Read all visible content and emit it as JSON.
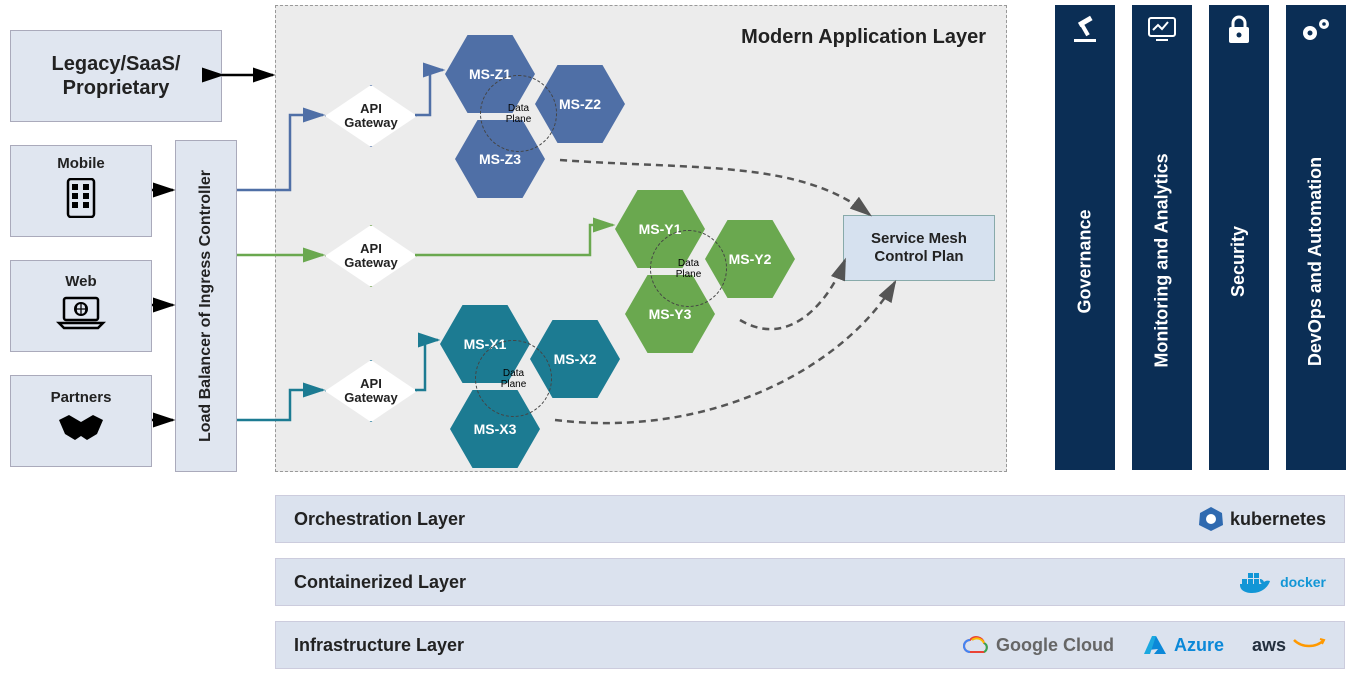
{
  "left": {
    "legacy": "Legacy/SaaS/\nProprietary",
    "clients": [
      {
        "label": "Mobile",
        "icon": "mobile-icon"
      },
      {
        "label": "Web",
        "icon": "laptop-icon"
      },
      {
        "label": "Partners",
        "icon": "handshake-icon"
      }
    ],
    "load_balancer": "Load Balancer of Ingress Controller"
  },
  "app_layer": {
    "title": "Modern Application Layer",
    "gateways": [
      "API\nGateway",
      "API\nGateway",
      "API\nGateway"
    ],
    "clusters": [
      {
        "color": "#4f6fa6",
        "nodes": [
          "MS-Z1",
          "MS-Z2",
          "MS-Z3"
        ],
        "data_plane": "Data\nPlane"
      },
      {
        "color": "#6aa84f",
        "nodes": [
          "MS-Y1",
          "MS-Y2",
          "MS-Y3"
        ],
        "data_plane": "Data\nPlane"
      },
      {
        "color": "#1c7b92",
        "nodes": [
          "MS-X1",
          "MS-X2",
          "MS-X3"
        ],
        "data_plane": "Data\nPlane"
      }
    ],
    "service_mesh": "Service Mesh\nControl Plan"
  },
  "pillars": [
    {
      "label": "Governance",
      "icon": "gavel-icon"
    },
    {
      "label": "Monitoring and Analytics",
      "icon": "analytics-icon"
    },
    {
      "label": "Security",
      "icon": "lock-icon"
    },
    {
      "label": "DevOps and Automation",
      "icon": "gears-icon"
    }
  ],
  "layers": [
    {
      "label": "Orchestration Layer",
      "logos": [
        "kubernetes"
      ]
    },
    {
      "label": "Containerized Layer",
      "logos": [
        "docker"
      ]
    },
    {
      "label": "Infrastructure Layer",
      "logos": [
        "Google Cloud",
        "Azure",
        "aws"
      ]
    }
  ],
  "colors": {
    "pillar_bg": "#0b2e55",
    "cluster_z": "#4f6fa6",
    "cluster_y": "#6aa84f",
    "cluster_x": "#1c7b92"
  }
}
